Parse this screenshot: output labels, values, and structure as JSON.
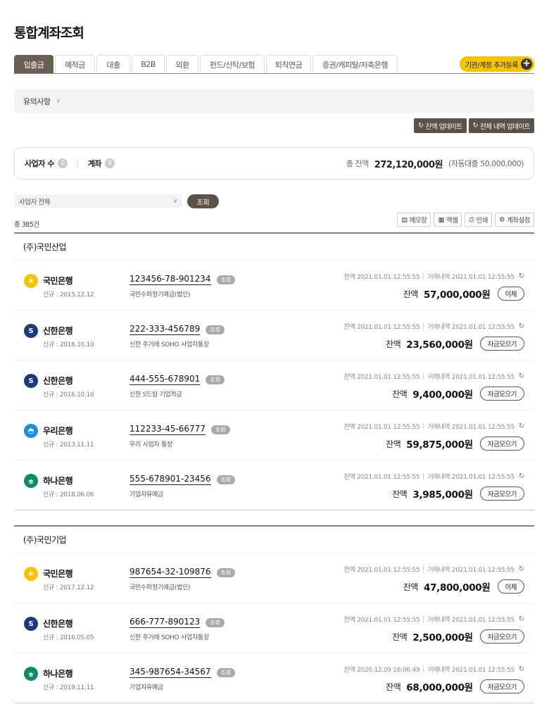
{
  "page_title": "통합계좌조회",
  "tabs": [
    {
      "label": "입출금",
      "active": true
    },
    {
      "label": "예적금"
    },
    {
      "label": "대출"
    },
    {
      "label": "B2B"
    },
    {
      "label": "외환"
    },
    {
      "label": "펀드/신탁/보험"
    },
    {
      "label": "퇴직연금"
    },
    {
      "label": "증권/캐피탈/저축은행"
    }
  ],
  "register_btn": "기관/계정 추가등록",
  "notice_label": "유의사항",
  "update_buttons": {
    "balance": "잔액 업데이트",
    "all": "전체 내역 업데이트"
  },
  "summary": {
    "business_label": "사업자 수",
    "business_count": "2",
    "account_label": "계좌",
    "account_count": "8",
    "total_label": "총 잔액",
    "total_value": "272,120,000원",
    "sub_value": "(자동대출 50,000,000)"
  },
  "filter": {
    "selected": "사업자 전체",
    "search_btn": "조회"
  },
  "total_count": "총 385건",
  "tools": {
    "memo": "메모장",
    "excel": "엑셀",
    "print": "인쇄",
    "settings": "계좌설정"
  },
  "groups": [
    {
      "title": "(주)국민산업",
      "rows": [
        {
          "bank": "국민은행",
          "logo_color": "#f5c400",
          "logo_text": "★",
          "opened": "신규 : 2015.12.12",
          "acct": "123456-78-901234",
          "inq": "조회",
          "acct_name": "국민수퍼정기예금(법인)",
          "ts_balance": "잔액 2021.01.01 12:55:55",
          "ts_tx": "거래내역 2021.01.01 12:55:55",
          "bal_label": "잔액",
          "balance": "57,000,000원",
          "action": "이체"
        },
        {
          "bank": "신한은행",
          "logo_color": "#1b3a7a",
          "logo_text": "S",
          "opened": "신규 : 2016.10.10",
          "acct": "222-333-456789",
          "inq": "조회",
          "acct_name": "신한 주거래 SOHO 사업자통장",
          "ts_balance": "잔액 2021.01.01 12:55:55",
          "ts_tx": "거래내역 2021.01.01 12:55:55",
          "bal_label": "잔액",
          "balance": "23,560,000원",
          "action": "자금모으기"
        },
        {
          "bank": "신한은행",
          "logo_color": "#1b3a7a",
          "logo_text": "S",
          "opened": "신규 : 2016.10.10",
          "acct": "444-555-678901",
          "inq": "조회",
          "acct_name": "신한 S드림 기업적금",
          "ts_balance": "잔액 2021.01.01 12:55:55",
          "ts_tx": "거래내역 2021.01.01 12:55:55",
          "bal_label": "잔액",
          "balance": "9,400,000원",
          "action": "자금모으기"
        },
        {
          "bank": "우리은행",
          "logo_color": "#1a8fd8",
          "logo_text": "◓",
          "opened": "신규 : 2013.11.11",
          "acct": "112233-45-66777",
          "inq": "조회",
          "acct_name": "우리 사업자 통장",
          "ts_balance": "잔액 2021.01.01 12:55:55",
          "ts_tx": "거래내역 2021.01.01 12:55:55",
          "bal_label": "잔액",
          "balance": "59,875,000원",
          "action": "자금모으기"
        },
        {
          "bank": "하나은행",
          "logo_color": "#0f8a6e",
          "logo_text": "ㅎ",
          "opened": "신규 : 2018.06.06",
          "acct": "555-678901-23456",
          "inq": "조회",
          "acct_name": "기업자유예금",
          "ts_balance": "잔액 2021.01.01 12:55:55",
          "ts_tx": "거래내역 2021.01.01 12:55:55",
          "bal_label": "잔액",
          "balance": "3,985,000원",
          "action": "자금모으기"
        }
      ]
    },
    {
      "title": "(주)국민기업",
      "rows": [
        {
          "bank": "국민은행",
          "logo_color": "#f5c400",
          "logo_text": "★",
          "opened": "신규 : 2017.12.12",
          "acct": "987654-32-109876",
          "inq": "조회",
          "acct_name": "국민수퍼정기예금(법인)",
          "ts_balance": "잔액 2021.01.01 12:55:55",
          "ts_tx": "거래내역 2021.01.01 12:55:55",
          "bal_label": "잔액",
          "balance": "47,800,000원",
          "action": "이체"
        },
        {
          "bank": "신한은행",
          "logo_color": "#1b3a7a",
          "logo_text": "S",
          "opened": "신규 : 2016.05.05",
          "acct": "666-777-890123",
          "inq": "조회",
          "acct_name": "신한 주거래 SOHO 사업자통장",
          "ts_balance": "잔액 2021.01.01 12:55:55",
          "ts_tx": "거래내역 2021.01.01 12:55:55",
          "bal_label": "잔액",
          "balance": "2,500,000원",
          "action": "자금모으기"
        },
        {
          "bank": "하나은행",
          "logo_color": "#0f8a6e",
          "logo_text": "ㅎ",
          "opened": "신규 : 2019.11.11",
          "acct": "345-987654-34567",
          "inq": "조회",
          "acct_name": "기업자유예금",
          "ts_balance": "잔액 2020.12.09 16:06:49",
          "ts_tx": "거래내역 2021.01.01 12:55:55",
          "bal_label": "잔액",
          "balance": "68,000,000원",
          "action": "자금모으기"
        }
      ]
    }
  ]
}
